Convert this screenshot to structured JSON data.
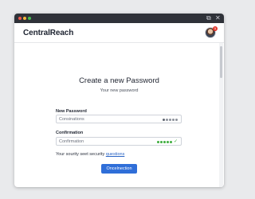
{
  "window": {
    "traffic_lights": [
      "close",
      "minimize",
      "zoom"
    ],
    "toolbar_icons": [
      "external-link-icon",
      "close-icon"
    ]
  },
  "header": {
    "brand": "CentralReach",
    "notification_count": "1"
  },
  "form": {
    "title": "Create a new Password",
    "subtitle": "Your new password",
    "new_password": {
      "label": "New Password",
      "value": "Consinations",
      "strength_dots": 5,
      "strength_color": "#8d929b"
    },
    "confirmation": {
      "label": "Confirmation",
      "value": "Confirmation",
      "strength_dots": 5,
      "strength_color": "#3fae3f",
      "valid": true
    },
    "hint_text": "Your sourity seet security",
    "hint_link": "questions",
    "submit_label": "Oncelnection"
  },
  "colors": {
    "accent": "#2f6ed8",
    "link": "#2a64c5",
    "success": "#3fae3f",
    "notification": "#e0352b"
  }
}
